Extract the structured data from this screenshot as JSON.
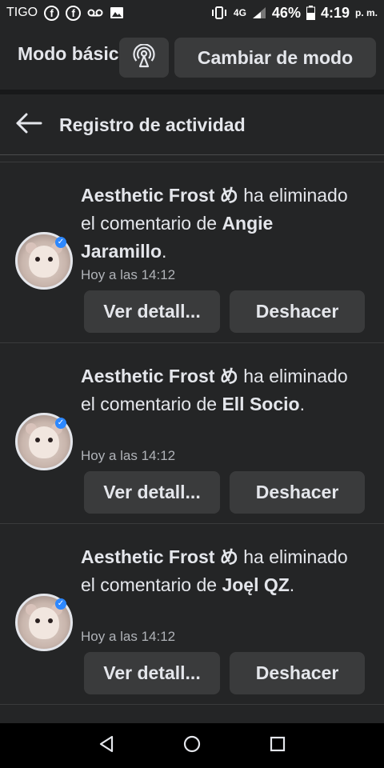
{
  "status_bar": {
    "carrier": "TIGO",
    "network_small": "4G",
    "battery": "46%",
    "time": "4:19",
    "ampm": "p. m."
  },
  "mode_bar": {
    "label": "Modo básico",
    "switch_button": "Cambiar de modo"
  },
  "header": {
    "title": "Registro de actividad"
  },
  "activities": [
    {
      "actor": "Aesthetic Frost め",
      "action_pre": " ha eliminado el comentario de ",
      "target": "Angie Jaramillo",
      "action_post": ".",
      "time": "Hoy a las 14:12",
      "details_button": "Ver detall...",
      "undo_button": "Deshacer"
    },
    {
      "actor": "Aesthetic Frost め",
      "action_pre": " ha eliminado el comentario de ",
      "target": "Ell Socio",
      "action_post": ".",
      "time": "Hoy a las 14:12",
      "details_button": "Ver detall...",
      "undo_button": "Deshacer"
    },
    {
      "actor": "Aesthetic Frost め",
      "action_pre": " ha eliminado el comentario de ",
      "target": "Joęl QZ",
      "action_post": ".",
      "time": "Hoy a las 14:12",
      "details_button": "Ver detall...",
      "undo_button": "Deshacer"
    }
  ],
  "icons": {
    "back": "arrow-left-icon",
    "broadcast": "broadcast-icon",
    "nav_back": "triangle-back-icon",
    "nav_home": "circle-home-icon",
    "nav_recents": "square-recents-icon"
  },
  "colors": {
    "background": "#242526",
    "button": "#3a3b3c",
    "text": "#e4e6eb",
    "muted": "#b0b3b8",
    "verified": "#2d88ff"
  }
}
